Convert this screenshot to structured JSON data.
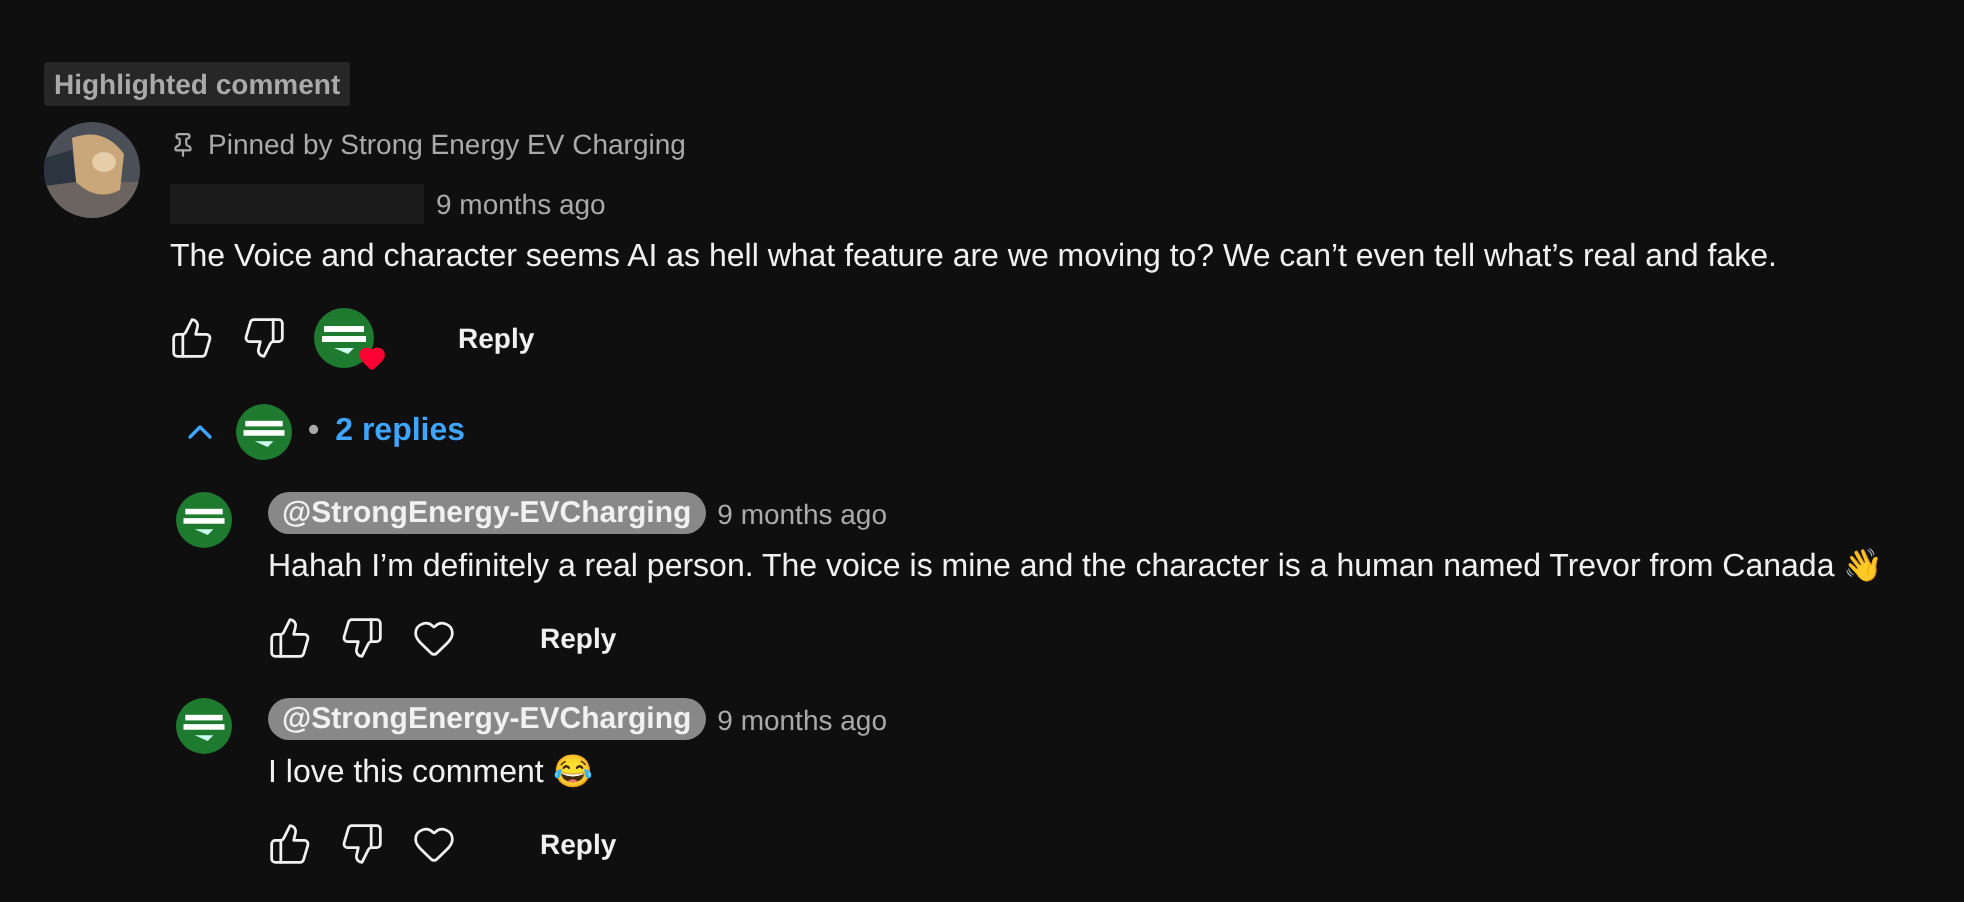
{
  "badge": "Highlighted comment",
  "comment": {
    "pinned_by": "Pinned by Strong Energy EV Charging",
    "time": "9 months ago",
    "text": "The Voice and character seems AI as hell what feature are we moving to? We can’t even tell what’s real and fake.",
    "hearted": true,
    "reply_label": "Reply"
  },
  "replies_toggle": {
    "expanded": true,
    "separator": "•",
    "label": "2 replies"
  },
  "replies": [
    {
      "author": "@StrongEnergy-EVCharging",
      "time": "9 months ago",
      "text": "Hahah I’m definitely a real person. The voice is mine and the character is a human named Trevor from Canada 👋",
      "hearted": false,
      "reply_label": "Reply"
    },
    {
      "author": "@StrongEnergy-EVCharging",
      "time": "9 months ago",
      "text": "I love this comment 😂",
      "hearted": false,
      "reply_label": "Reply"
    }
  ]
}
